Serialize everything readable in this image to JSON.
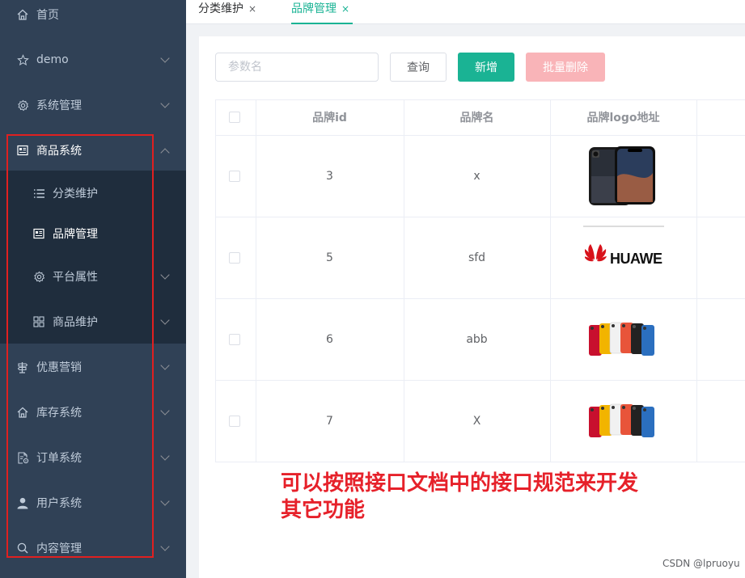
{
  "sidebar": {
    "items": [
      {
        "label": "首页",
        "icon": "home-icon"
      },
      {
        "label": "demo",
        "icon": "star-icon"
      },
      {
        "label": "系统管理",
        "icon": "gear-icon"
      },
      {
        "label": "商品系统",
        "icon": "list-panel-icon"
      },
      {
        "label": "优惠营销",
        "icon": "signpost-icon"
      },
      {
        "label": "库存系统",
        "icon": "home-icon"
      },
      {
        "label": "订单系统",
        "icon": "document-gear-icon"
      },
      {
        "label": "用户系统",
        "icon": "user-icon"
      },
      {
        "label": "内容管理",
        "icon": "search-icon"
      }
    ],
    "submenu": [
      {
        "label": "分类维护",
        "icon": "list-icon"
      },
      {
        "label": "品牌管理",
        "icon": "list-panel-icon"
      },
      {
        "label": "平台属性",
        "icon": "gear-icon"
      },
      {
        "label": "商品维护",
        "icon": "grid-icon"
      }
    ]
  },
  "tabs": [
    {
      "label": "分类维护",
      "close": "×"
    },
    {
      "label": "品牌管理",
      "close": "×"
    }
  ],
  "toolbar": {
    "search_placeholder": "参数名",
    "query_label": "查询",
    "add_label": "新增",
    "batch_delete_label": "批量删除"
  },
  "table": {
    "headers": [
      "品牌id",
      "品牌名",
      "品牌logo地址"
    ],
    "rows": [
      {
        "id": "3",
        "name": "x",
        "logo": "iphone-xr-phone-image"
      },
      {
        "id": "5",
        "name": "sfd",
        "logo": "HUAWEI"
      },
      {
        "id": "6",
        "name": "abb",
        "logo": "iphone-xr-colors-image"
      },
      {
        "id": "7",
        "name": "X",
        "logo": "iphone-xr-colors-image"
      }
    ]
  },
  "annotation": {
    "line1": "可以按照接口文档中的接口规范来开发",
    "line2": "其它功能"
  },
  "watermark": "CSDN @lpruoyu",
  "colors": {
    "sidebar_bg": "#304156",
    "submenu_bg": "#1f2d3d",
    "accent": "#1ab394",
    "danger_disabled": "#f9b4b8",
    "annotation_red": "#e6212a"
  }
}
